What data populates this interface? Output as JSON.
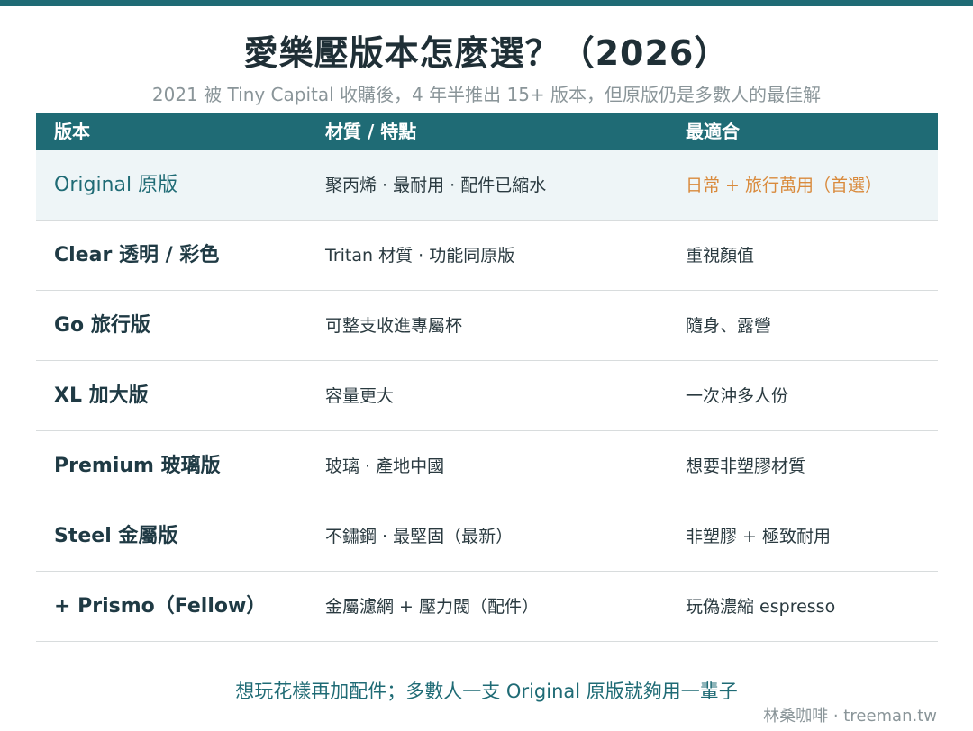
{
  "title": "愛樂壓版本怎麼選？（2026）",
  "subtitle": "2021 被 Tiny Capital 收購後，4 年半推出 15+ 版本，但原版仍是多數人的最佳解",
  "table": {
    "headers": [
      "版本",
      "材質 / 特點",
      "最適合"
    ],
    "rows": [
      {
        "name": "Original 原版",
        "material": "聚丙烯 · 最耐用 · 配件已縮水",
        "fit": "日常 + 旅行萬用（首選）"
      },
      {
        "name": "Clear 透明 / 彩色",
        "material": "Tritan 材質 · 功能同原版",
        "fit": "重視顏值"
      },
      {
        "name": "Go 旅行版",
        "material": "可整支收進專屬杯",
        "fit": "隨身、露營"
      },
      {
        "name": "XL 加大版",
        "material": "容量更大",
        "fit": "一次沖多人份"
      },
      {
        "name": "Premium 玻璃版",
        "material": "玻璃 · 產地中國",
        "fit": "想要非塑膠材質"
      },
      {
        "name": "Steel 金屬版",
        "material": "不鏽鋼 · 最堅固（最新）",
        "fit": "非塑膠 + 極致耐用"
      },
      {
        "name": "+ Prismo（Fellow）",
        "material": "金屬濾網 + 壓力閥（配件）",
        "fit": "玩偽濃縮 espresso"
      }
    ]
  },
  "footer_note": "想玩花樣再加配件；多數人一支 Original 原版就夠用一輩子",
  "credit": "林桑咖啡 · treeman.tw",
  "colors": {
    "accent": "#1f6b75",
    "highlight_row_bg": "#eef5f7",
    "recommend": "#d98a3c"
  }
}
